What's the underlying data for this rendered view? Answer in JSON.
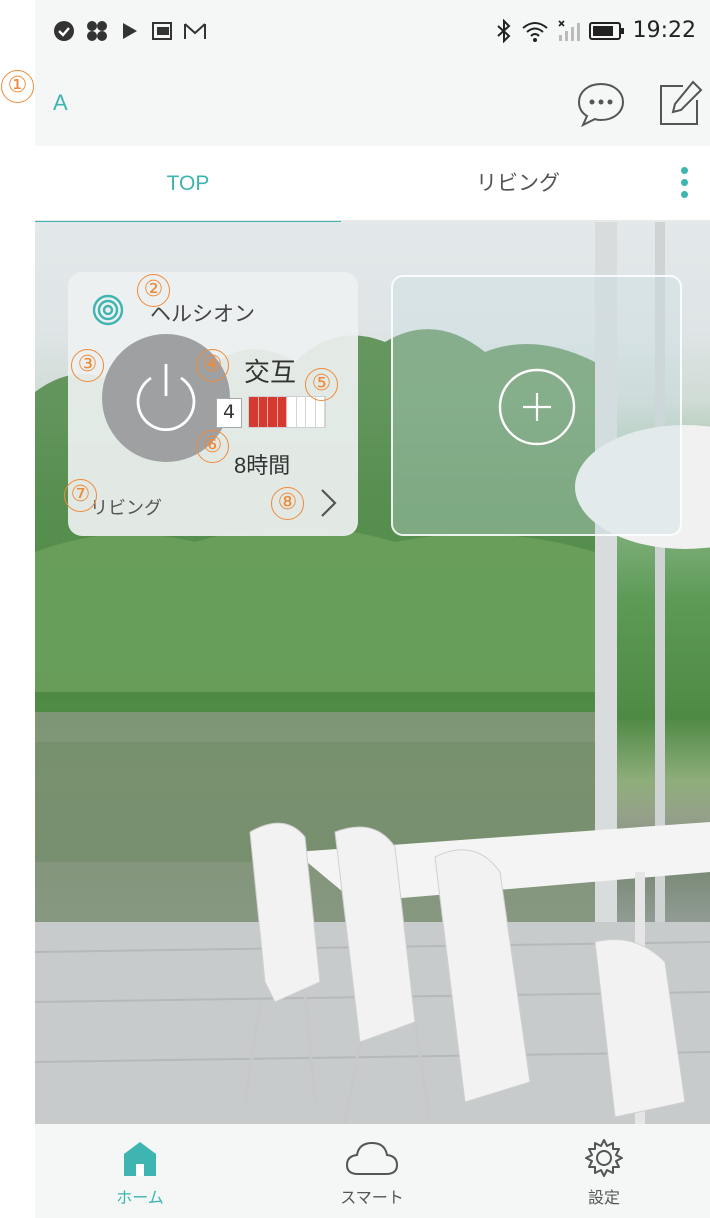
{
  "status_bar": {
    "left_icons": [
      "check-circle-icon",
      "fan-icon",
      "play-icon",
      "sim-icon",
      "gmail-icon"
    ],
    "right_icons": [
      "bluetooth-icon",
      "wifi-icon",
      "signal-icon",
      "battery-icon"
    ],
    "time": "19:22"
  },
  "header": {
    "profile_label": "A",
    "actions": [
      "chat-icon",
      "edit-icon"
    ]
  },
  "tabs": [
    {
      "label": "TOP",
      "active": true
    },
    {
      "label": "リビング",
      "active": false
    }
  ],
  "device_card": {
    "name": "ヘルシオン",
    "mode": "交互",
    "level": "4",
    "level_fraction": 0.5,
    "timer": "8時間",
    "room": "リビング"
  },
  "annotations": [
    "①",
    "②",
    "③",
    "④",
    "⑤",
    "⑥",
    "⑦",
    "⑧"
  ],
  "bottom_nav": [
    {
      "label": "ホーム",
      "icon": "home-icon",
      "active": true
    },
    {
      "label": "スマート",
      "icon": "cloud-icon",
      "active": false
    },
    {
      "label": "設定",
      "icon": "gear-icon",
      "active": false
    }
  ],
  "colors": {
    "accent": "#3eb5b0",
    "level_bar": "#d6392f",
    "annotation": "#ef8a3a"
  }
}
